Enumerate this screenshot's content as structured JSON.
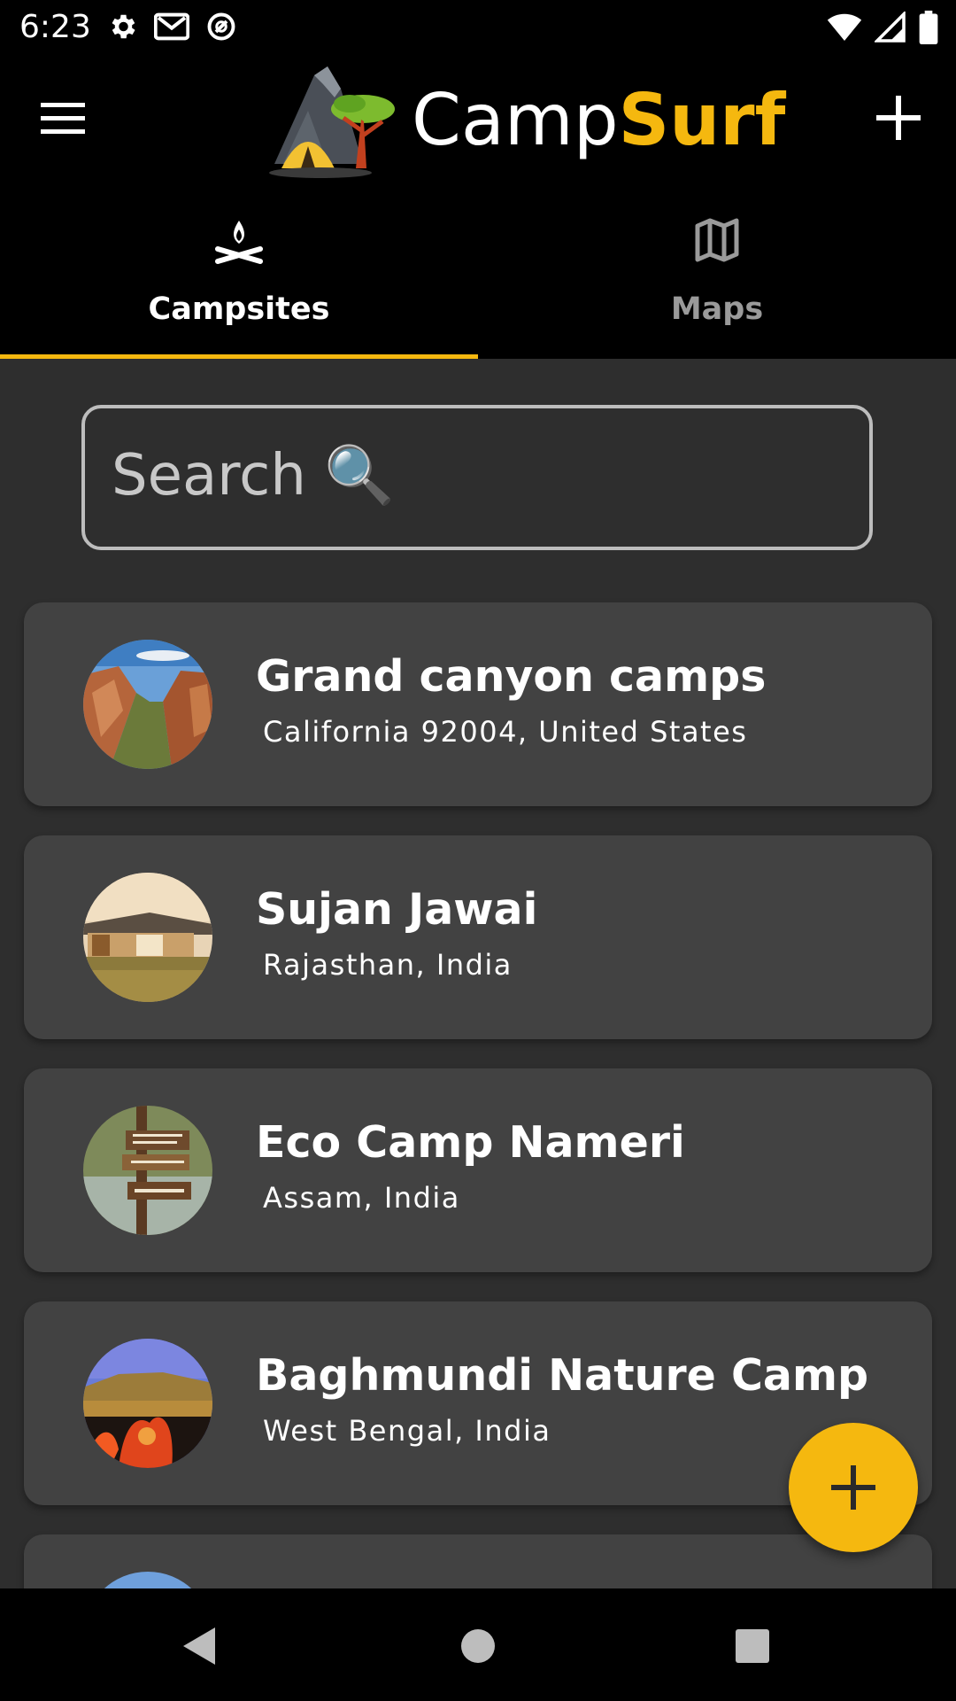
{
  "status_bar": {
    "time": "6:23",
    "left_icons": [
      "settings-icon",
      "gmail-icon",
      "blocked-icon"
    ],
    "right_icons": [
      "wifi-icon",
      "signal-icon",
      "battery-icon"
    ]
  },
  "app_bar": {
    "brand_part1": "Camp",
    "brand_part2": "Surf",
    "brand_color": "#f5b80f"
  },
  "tabs": [
    {
      "label": "Campsites",
      "icon": "campfire-icon",
      "selected": true
    },
    {
      "label": "Maps",
      "icon": "map-icon",
      "selected": false
    }
  ],
  "search": {
    "placeholder": "Search 🔍"
  },
  "campsites": [
    {
      "name": "Grand canyon camps",
      "location": "California 92004,  United States",
      "image": "canyon-photo"
    },
    {
      "name": "Sujan Jawai",
      "location": "Rajasthan,  India",
      "image": "tent-photo"
    },
    {
      "name": "Eco Camp Nameri",
      "location": "Assam,  India",
      "image": "signboard-photo"
    },
    {
      "name": "Baghmundi Nature Camp",
      "location": "West Bengal,  India",
      "image": "flowers-photo"
    },
    {
      "name": "",
      "location": "",
      "image": "sky-photo"
    }
  ],
  "fab": {
    "icon": "plus-icon"
  },
  "nav": [
    "back-icon",
    "home-icon",
    "recents-icon"
  ]
}
